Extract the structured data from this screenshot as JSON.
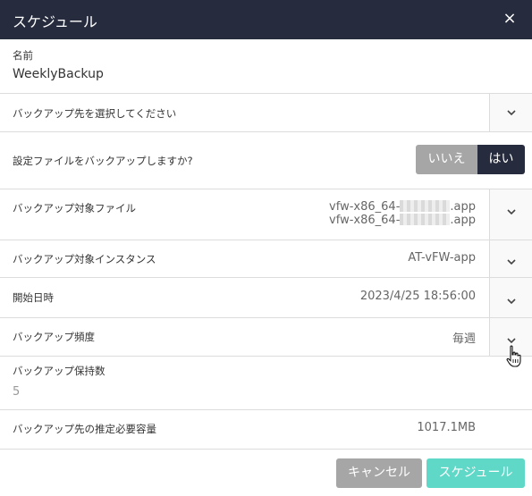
{
  "dialog": {
    "title": "スケジュール",
    "close_icon": "×"
  },
  "name_field": {
    "label": "名前",
    "value": "WeeklyBackup"
  },
  "destination": {
    "placeholder": "バックアップ先を選択してください"
  },
  "config_backup": {
    "label": "設定ファイルをバックアップしますか?",
    "options": [
      "いいえ",
      "はい"
    ],
    "selected": "はい"
  },
  "target_files": {
    "label": "バックアップ対象ファイル",
    "files": [
      "vfw-x86_64-",
      "vfw-x86_64-"
    ],
    "suffix": ".app"
  },
  "target_instance": {
    "label": "バックアップ対象インスタンス",
    "value": "AT-vFW-app"
  },
  "start_datetime": {
    "label": "開始日時",
    "value": "2023/4/25 18:56:00"
  },
  "frequency": {
    "label": "バックアップ頻度",
    "value": "毎週"
  },
  "retention": {
    "label": "バックアップ保持数",
    "value": "5"
  },
  "estimated_size": {
    "label": "バックアップ先の推定必要容量",
    "value": "1017.1MB"
  },
  "footer": {
    "cancel_label": "キャンセル",
    "schedule_label": "スケジュール"
  },
  "colors": {
    "header_bg": "#262b3d",
    "toggle_selected": "#262b3d",
    "toggle_unselected": "#a6a6a6",
    "primary_button": "#5fd8c8",
    "secondary_button": "#a6a6a6"
  }
}
